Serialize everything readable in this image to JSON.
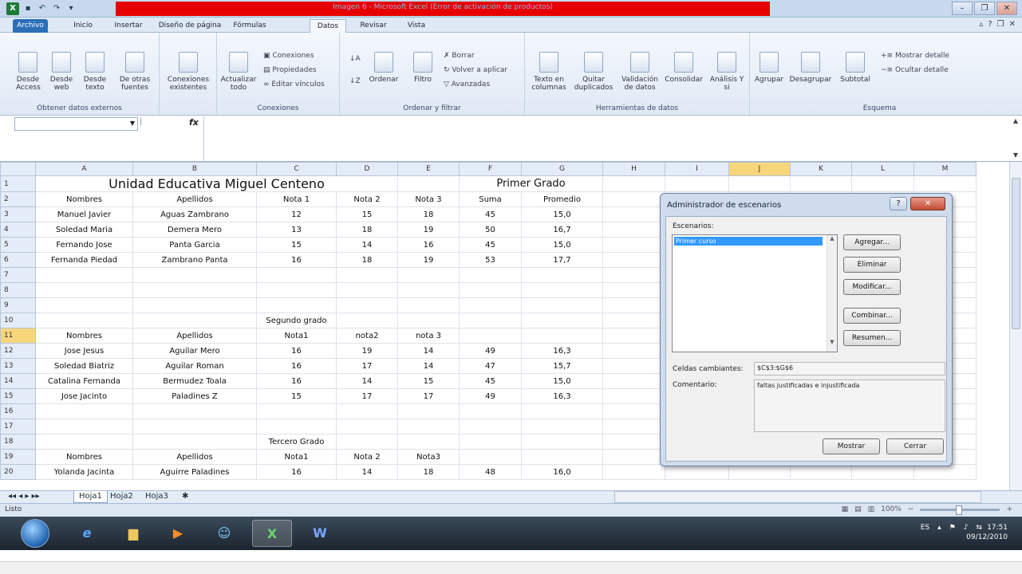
{
  "window": {
    "title": "Imagen 6 - Microsoft Excel (Error de activación de productos)",
    "quick_access": [
      "save-icon",
      "undo-icon",
      "redo-icon"
    ]
  },
  "tabs": [
    "Archivo",
    "Inicio",
    "Insertar",
    "Diseño de página",
    "Fórmulas",
    "Datos",
    "Revisar",
    "Vista"
  ],
  "ribbon": {
    "groups": {
      "externos": "Obtener datos externos",
      "conexiones": "Conexiones",
      "ordenar": "Ordenar y filtrar",
      "herramientas": "Herramientas de datos",
      "esquema": "Esquema"
    },
    "btn": {
      "desde_access": "Desde Access",
      "desde_web": "Desde web",
      "desde_texto": "Desde texto",
      "otras_fuentes": "De otras fuentes",
      "conexiones_existentes": "Conexiones existentes",
      "actualizar": "Actualizar todo",
      "conexiones": "Conexiones",
      "propiedades": "Propiedades",
      "editar_vinculos": "Editar vínculos",
      "ordenar": "Ordenar",
      "filtro": "Filtro",
      "borrar": "Borrar",
      "volver_aplicar": "Volver a aplicar",
      "avanzadas": "Avanzadas",
      "texto_columnas": "Texto en columnas",
      "quitar_duplicados": "Quitar duplicados",
      "validacion": "Validación de datos",
      "consolidar": "Consolidar",
      "analisis": "Análisis Y si",
      "agrupar": "Agrupar",
      "desagrupar": "Desagrupar",
      "subtotal": "Subtotal",
      "mostrar_detalle": "Mostrar detalle",
      "ocultar_detalle": "Ocultar detalle"
    }
  },
  "formula_bar": {
    "name_box": "",
    "fx": "fx",
    "content": ""
  },
  "columns": [
    "A",
    "B",
    "C",
    "D",
    "E",
    "F",
    "G",
    "H",
    "I",
    "J",
    "K",
    "L",
    "M"
  ],
  "selected_column": "J",
  "selected_row": "11",
  "rows": [
    {
      "n": "1",
      "c": [
        "Unidad Educativa Miguel Centeno",
        "",
        "",
        "",
        "",
        "Primer Grado",
        "",
        "",
        "",
        "",
        "",
        "",
        ""
      ]
    },
    {
      "n": "2",
      "c": [
        "Nombres",
        "Apellidos",
        "Nota 1",
        "Nota 2",
        "Nota 3",
        "Suma",
        "Promedio",
        "",
        "",
        "",
        "",
        "",
        ""
      ]
    },
    {
      "n": "3",
      "c": [
        "Manuel Javier",
        "Aguas Zambrano",
        "12",
        "15",
        "18",
        "45",
        "15,0",
        "",
        "",
        "",
        "",
        "",
        ""
      ]
    },
    {
      "n": "4",
      "c": [
        "Soledad Maria",
        "Demera Mero",
        "13",
        "18",
        "19",
        "50",
        "16,7",
        "",
        "",
        "",
        "",
        "",
        ""
      ]
    },
    {
      "n": "5",
      "c": [
        "Fernando Jose",
        "Panta Garcia",
        "15",
        "14",
        "16",
        "45",
        "15,0",
        "",
        "",
        "",
        "",
        "",
        ""
      ]
    },
    {
      "n": "6",
      "c": [
        "Fernanda Piedad",
        "Zambrano Panta",
        "16",
        "18",
        "19",
        "53",
        "17,7",
        "",
        "",
        "",
        "",
        "",
        ""
      ]
    },
    {
      "n": "7",
      "c": [
        "",
        "",
        "",
        "",
        "",
        "",
        "",
        "",
        "",
        "",
        "",
        "",
        ""
      ]
    },
    {
      "n": "8",
      "c": [
        "",
        "",
        "",
        "",
        "",
        "",
        "",
        "",
        "",
        "",
        "",
        "",
        ""
      ]
    },
    {
      "n": "9",
      "c": [
        "",
        "",
        "",
        "",
        "",
        "",
        "",
        "",
        "",
        "",
        "",
        "",
        ""
      ]
    },
    {
      "n": "10",
      "c": [
        "",
        "",
        "Segundo grado",
        "",
        "",
        "",
        "",
        "",
        "",
        "",
        "",
        "",
        ""
      ]
    },
    {
      "n": "11",
      "c": [
        "Nombres",
        "Apellidos",
        "Nota1",
        "nota2",
        "nota 3",
        "",
        "",
        "",
        "",
        "",
        "",
        "",
        ""
      ]
    },
    {
      "n": "12",
      "c": [
        "Jose Jesus",
        "Aguilar Mero",
        "16",
        "19",
        "14",
        "49",
        "16,3",
        "",
        "",
        "",
        "",
        "",
        ""
      ]
    },
    {
      "n": "13",
      "c": [
        "Soledad Biatriz",
        "Aguilar Roman",
        "16",
        "17",
        "14",
        "47",
        "15,7",
        "",
        "",
        "",
        "",
        "",
        ""
      ]
    },
    {
      "n": "14",
      "c": [
        "Catalina Fernanda",
        "Bermudez Toala",
        "16",
        "14",
        "15",
        "45",
        "15,0",
        "",
        "",
        "",
        "",
        "",
        ""
      ]
    },
    {
      "n": "15",
      "c": [
        "Jose Jacinto",
        "Paladines Z",
        "15",
        "17",
        "17",
        "49",
        "16,3",
        "",
        "",
        "",
        "",
        "",
        ""
      ]
    },
    {
      "n": "16",
      "c": [
        "",
        "",
        "",
        "",
        "",
        "",
        "",
        "",
        "",
        "",
        "",
        "",
        ""
      ]
    },
    {
      "n": "17",
      "c": [
        "",
        "",
        "",
        "",
        "",
        "",
        "",
        "",
        "",
        "",
        "",
        "",
        ""
      ]
    },
    {
      "n": "18",
      "c": [
        "",
        "",
        "Tercero Grado",
        "",
        "",
        "",
        "",
        "",
        "",
        "",
        "",
        "",
        ""
      ]
    },
    {
      "n": "19",
      "c": [
        "Nombres",
        "Apellidos",
        "Nota1",
        "Nota 2",
        "Nota3",
        "",
        "",
        "",
        "",
        "",
        "",
        "",
        ""
      ]
    },
    {
      "n": "20",
      "c": [
        "Yolanda Jacinta",
        "Aguirre Paladines",
        "16",
        "14",
        "18",
        "48",
        "16,0",
        "",
        "",
        "",
        "",
        "",
        ""
      ]
    }
  ],
  "sheet_tabs": [
    "Hoja1",
    "Hoja2",
    "Hoja3"
  ],
  "status": {
    "ready": "Listo",
    "zoom": "100%"
  },
  "taskbar": {
    "lang": "ES",
    "time": "17:51",
    "date": "09/12/2010"
  },
  "dialog": {
    "title": "Administrador de escenarios",
    "scenarios_label": "Escenarios:",
    "scenarios": [
      "Primer curso"
    ],
    "buttons": {
      "agregar": "Agregar...",
      "eliminar": "Eliminar",
      "modificar": "Modificar...",
      "combinar": "Combinar...",
      "resumen": "Resumen...",
      "mostrar": "Mostrar",
      "cerrar": "Cerrar"
    },
    "changing_cells_label": "Celdas cambiantes:",
    "changing_cells": "$C$3:$G$6",
    "comment_label": "Comentario:",
    "comment": "faltas justificadas e injustificada"
  }
}
